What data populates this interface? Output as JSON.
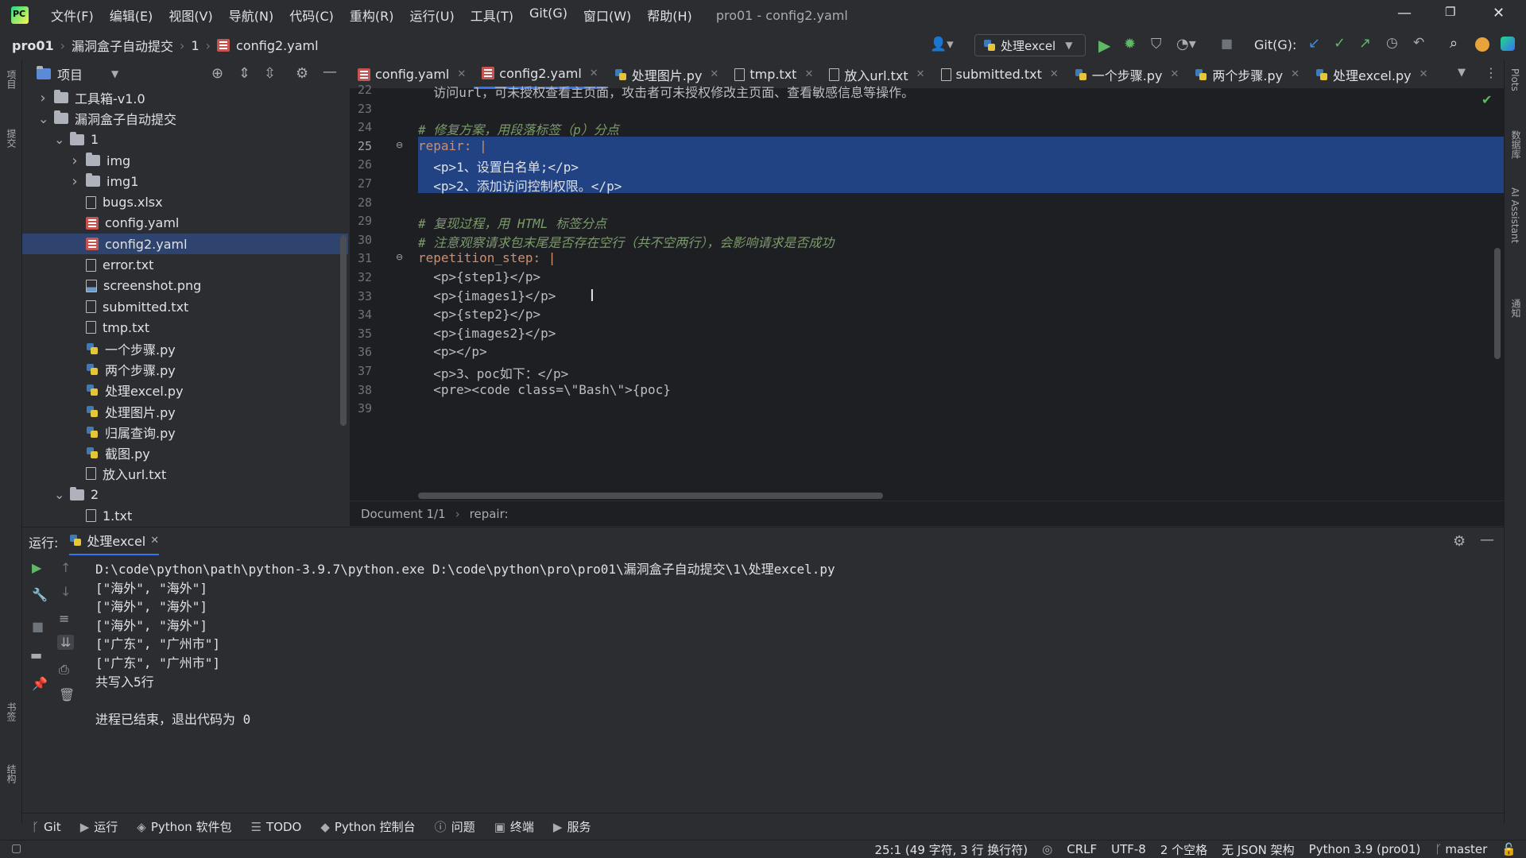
{
  "titlebar": {
    "menu": [
      "文件(F)",
      "编辑(E)",
      "视图(V)",
      "导航(N)",
      "代码(C)",
      "重构(R)",
      "运行(U)",
      "工具(T)",
      "Git(G)",
      "窗口(W)",
      "帮助(H)"
    ],
    "window_title": "pro01 - config2.yaml"
  },
  "navbar": {
    "project": "pro01",
    "crumb1": "漏洞盒子自动提交",
    "crumb2": "1",
    "file": "config2.yaml",
    "run_config": "处理excel",
    "git_label": "Git(G):"
  },
  "project_panel": {
    "title": "项目",
    "items": [
      {
        "label": "工具箱-v1.0",
        "kind": "folder",
        "depth": 1,
        "expanded": false
      },
      {
        "label": "漏洞盒子自动提交",
        "kind": "folder",
        "depth": 1,
        "expanded": true
      },
      {
        "label": "1",
        "kind": "folder",
        "depth": 2,
        "expanded": true
      },
      {
        "label": "img",
        "kind": "folder",
        "depth": 3,
        "expanded": false
      },
      {
        "label": "img1",
        "kind": "folder",
        "depth": 3,
        "expanded": false
      },
      {
        "label": "bugs.xlsx",
        "kind": "xls",
        "depth": 3
      },
      {
        "label": "config.yaml",
        "kind": "yaml",
        "depth": 3
      },
      {
        "label": "config2.yaml",
        "kind": "yaml",
        "depth": 3,
        "selected": true
      },
      {
        "label": "error.txt",
        "kind": "txt",
        "depth": 3
      },
      {
        "label": "screenshot.png",
        "kind": "png",
        "depth": 3
      },
      {
        "label": "submitted.txt",
        "kind": "txt",
        "depth": 3
      },
      {
        "label": "tmp.txt",
        "kind": "txt",
        "depth": 3
      },
      {
        "label": "一个步骤.py",
        "kind": "py",
        "depth": 3
      },
      {
        "label": "两个步骤.py",
        "kind": "py",
        "depth": 3
      },
      {
        "label": "处理excel.py",
        "kind": "py",
        "depth": 3
      },
      {
        "label": "处理图片.py",
        "kind": "py",
        "depth": 3
      },
      {
        "label": "归属查询.py",
        "kind": "py",
        "depth": 3
      },
      {
        "label": "截图.py",
        "kind": "py",
        "depth": 3
      },
      {
        "label": "放入url.txt",
        "kind": "txt",
        "depth": 3
      },
      {
        "label": "2",
        "kind": "folder",
        "depth": 2,
        "expanded": true
      },
      {
        "label": "1.txt",
        "kind": "txt",
        "depth": 3
      }
    ]
  },
  "tabs": [
    {
      "label": "config.yaml",
      "kind": "yaml"
    },
    {
      "label": "config2.yaml",
      "kind": "yaml",
      "active": true
    },
    {
      "label": "处理图片.py",
      "kind": "py"
    },
    {
      "label": "tmp.txt",
      "kind": "txt"
    },
    {
      "label": "放入url.txt",
      "kind": "txt"
    },
    {
      "label": "submitted.txt",
      "kind": "txt"
    },
    {
      "label": "一个步骤.py",
      "kind": "py"
    },
    {
      "label": "两个步骤.py",
      "kind": "py"
    },
    {
      "label": "处理excel.py",
      "kind": "py"
    }
  ],
  "editor": {
    "lines": [
      {
        "n": "22",
        "text": "  访问url，可未授权查看主页面，攻击者可未授权修改主页面、查看敏感信息等操作。",
        "style": "plain"
      },
      {
        "n": "23",
        "text": "",
        "style": "plain"
      },
      {
        "n": "24",
        "text": "# 修复方案，用段落标签（p）分点",
        "style": "comment"
      },
      {
        "n": "25",
        "text": "repair: |",
        "style": "key",
        "selected": true,
        "current": true
      },
      {
        "n": "26",
        "text": "  <p>1、设置白名单;</p>",
        "style": "plain",
        "selected": true
      },
      {
        "n": "27",
        "text": "  <p>2、添加访问控制权限。</p>",
        "style": "plain",
        "selected": true
      },
      {
        "n": "28",
        "text": "",
        "style": "plain"
      },
      {
        "n": "29",
        "text": "# 复现过程，用 HTML 标签分点",
        "style": "comment"
      },
      {
        "n": "30",
        "text": "# 注意观察请求包末尾是否存在空行（共不空两行），会影响请求是否成功",
        "style": "comment"
      },
      {
        "n": "31",
        "text": "repetition_step: |",
        "style": "key"
      },
      {
        "n": "32",
        "text": "  <p>{step1}</p>",
        "style": "plain"
      },
      {
        "n": "33",
        "text": "  <p>{images1}</p>",
        "style": "plain"
      },
      {
        "n": "34",
        "text": "  <p>{step2}</p>",
        "style": "plain"
      },
      {
        "n": "35",
        "text": "  <p>{images2}</p>",
        "style": "plain"
      },
      {
        "n": "36",
        "text": "  <p></p>",
        "style": "plain"
      },
      {
        "n": "37",
        "text": "  <p>3、poc如下：</p>",
        "style": "plain"
      },
      {
        "n": "38",
        "text": "  <pre><code class=\\\"Bash\\\">{poc}",
        "style": "plain"
      },
      {
        "n": "39",
        "text": "",
        "style": "plain"
      }
    ],
    "status_doc": "Document 1/1",
    "status_path": "repair:"
  },
  "run_panel": {
    "label": "运行:",
    "tab": "处理excel",
    "console": [
      "D:\\code\\python\\path\\python-3.9.7\\python.exe D:\\code\\python\\pro\\pro01\\漏洞盒子自动提交\\1\\处理excel.py",
      "[\"海外\", \"海外\"]",
      "[\"海外\", \"海外\"]",
      "[\"海外\", \"海外\"]",
      "[\"广东\", \"广州市\"]",
      "[\"广东\", \"广州市\"]",
      "共写入5行",
      "",
      "进程已结束，退出代码为 0"
    ]
  },
  "bottom_tabs": [
    "Git",
    "运行",
    "Python 软件包",
    "TODO",
    "Python 控制台",
    "问题",
    "终端",
    "服务"
  ],
  "statusbar": {
    "position": "25:1 (49 字符, 3 行 换行符)",
    "line_sep": "CRLF",
    "encoding": "UTF-8",
    "indent": "2 个空格",
    "schema": "无 JSON 架构",
    "interpreter": "Python 3.9 (pro01)",
    "branch": "master"
  },
  "right_stripe": [
    "Plots",
    "数据库",
    "AI Assistant",
    "通知"
  ],
  "left_stripe": [
    "项目",
    "提交",
    "书签",
    "结构"
  ]
}
